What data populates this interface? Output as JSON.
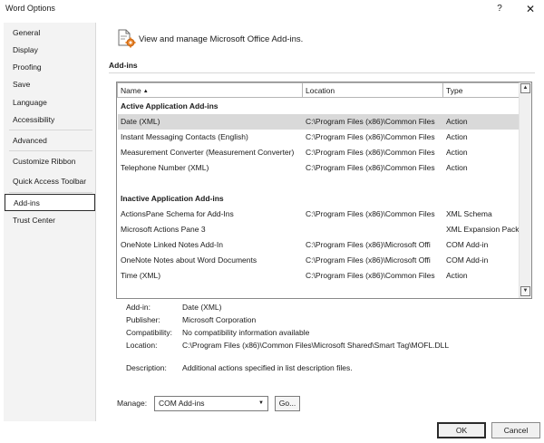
{
  "window": {
    "title": "Word Options",
    "help": "?",
    "close": "✕"
  },
  "sidebar": {
    "items": [
      {
        "label": "General"
      },
      {
        "label": "Display"
      },
      {
        "label": "Proofing"
      },
      {
        "label": "Save"
      },
      {
        "label": "Language"
      },
      {
        "label": "Accessibility"
      },
      {
        "label": "Advanced"
      },
      {
        "label": "Customize Ribbon"
      },
      {
        "label": "Quick Access Toolbar"
      },
      {
        "label": "Add-ins"
      },
      {
        "label": "Trust Center"
      }
    ],
    "active": "Add-ins"
  },
  "header": {
    "text": "View and manage Microsoft Office Add-ins.",
    "icon": "add-ins-gear-icon"
  },
  "section": {
    "title": "Add-ins"
  },
  "list": {
    "columns": {
      "name": "Name",
      "location": "Location",
      "type": "Type"
    },
    "sort_glyph": "▲",
    "groups": [
      {
        "title": "Active Application Add-ins",
        "rows": [
          {
            "name": "Date (XML)",
            "location": "C:\\Program Files (x86)\\Common Files",
            "type": "Action",
            "selected": true
          },
          {
            "name": "Instant Messaging Contacts (English)",
            "location": "C:\\Program Files (x86)\\Common Files",
            "type": "Action"
          },
          {
            "name": "Measurement Converter (Measurement Converter)",
            "location": "C:\\Program Files (x86)\\Common Files",
            "type": "Action"
          },
          {
            "name": "Telephone Number (XML)",
            "location": "C:\\Program Files (x86)\\Common Files",
            "type": "Action"
          }
        ]
      },
      {
        "title": "Inactive Application Add-ins",
        "rows": [
          {
            "name": "ActionsPane Schema for Add-Ins",
            "location": "C:\\Program Files (x86)\\Common Files",
            "type": "XML Schema"
          },
          {
            "name": "Microsoft Actions Pane 3",
            "location": "",
            "type": "XML Expansion Pack"
          },
          {
            "name": "OneNote Linked Notes Add-In",
            "location": "C:\\Program Files (x86)\\Microsoft Offi",
            "type": "COM Add-in"
          },
          {
            "name": "OneNote Notes about Word Documents",
            "location": "C:\\Program Files (x86)\\Microsoft Offi",
            "type": "COM Add-in"
          },
          {
            "name": "Time (XML)",
            "location": "C:\\Program Files (x86)\\Common Files",
            "type": "Action"
          }
        ]
      }
    ],
    "scroll_up": "▲",
    "scroll_down": "▼"
  },
  "details": {
    "addin_label": "Add-in:",
    "addin": "Date (XML)",
    "publisher_label": "Publisher:",
    "publisher": "Microsoft Corporation",
    "compat_label": "Compatibility:",
    "compat": "No compatibility information available",
    "location_label": "Location:",
    "location": "C:\\Program Files (x86)\\Common Files\\Microsoft Shared\\Smart Tag\\MOFL.DLL",
    "description_label": "Description:",
    "description": "Additional actions specified in list description files."
  },
  "manage": {
    "label": "Manage:",
    "value": "COM Add-ins",
    "dropdown": "▼",
    "go": "Go..."
  },
  "buttons": {
    "ok": "OK",
    "cancel": "Cancel"
  }
}
